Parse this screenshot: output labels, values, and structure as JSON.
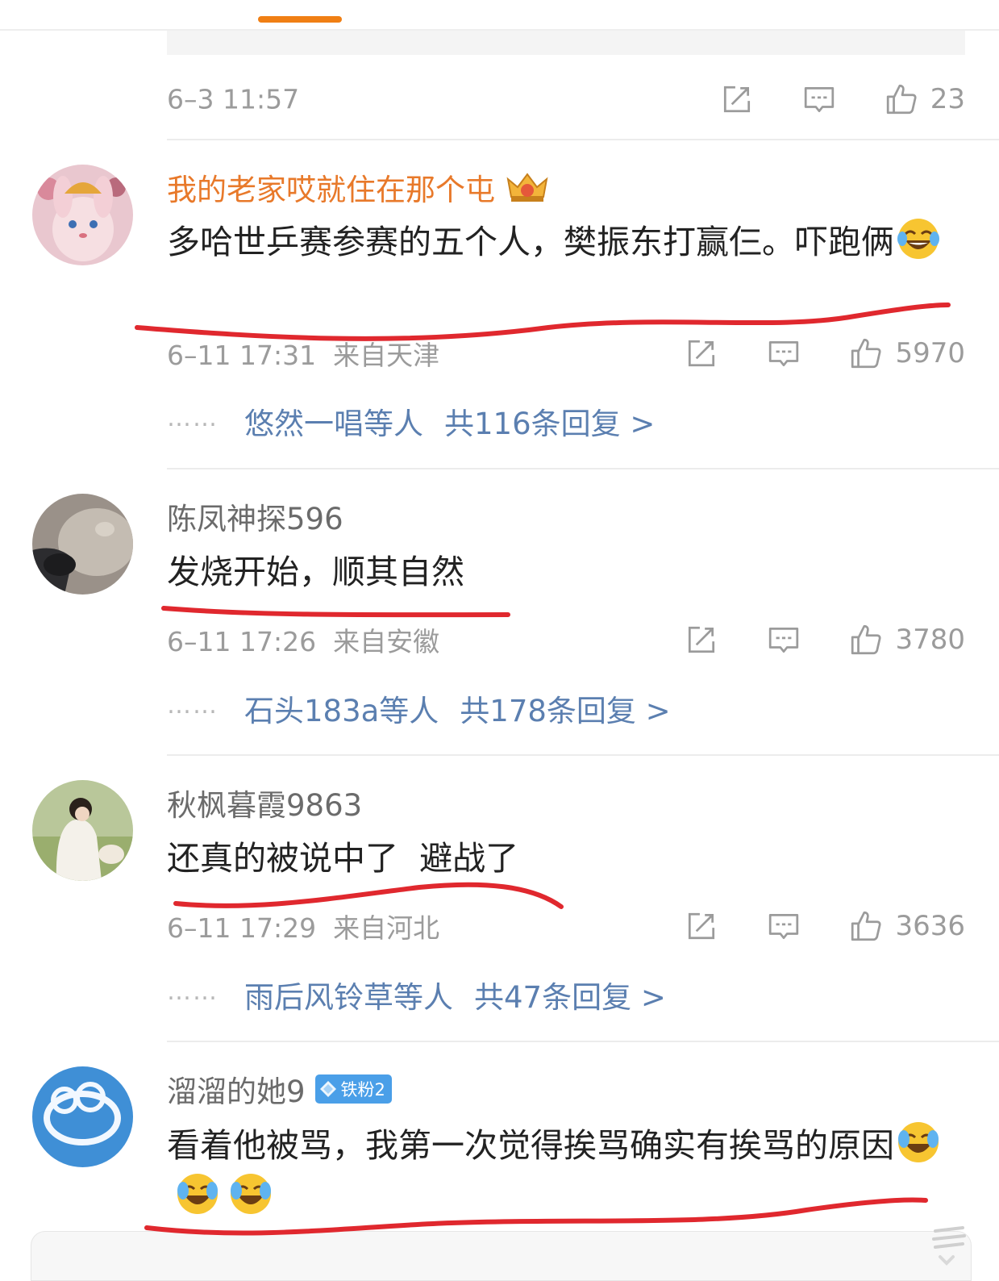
{
  "top": {
    "previous_meta": {
      "time": "6–3 11:57",
      "likes": "23"
    }
  },
  "comments": [
    {
      "username": "我的老家哎就住在那个屯",
      "has_crown": true,
      "text": "多哈世乒赛参赛的五个人，樊振东打赢仨。吓跑俩",
      "emoji_count": 1,
      "meta": {
        "time": "6–11 17:31",
        "location": "来自天津",
        "likes": "5970"
      },
      "replies": {
        "who": "悠然一唱等人",
        "total": "共116条回复 >"
      }
    },
    {
      "username": "陈凤神探596",
      "text": "发烧开始，顺其自然",
      "meta": {
        "time": "6–11 17:26",
        "location": "来自安徽",
        "likes": "3780"
      },
      "replies": {
        "who": "石头183a等人",
        "total": "共178条回复 >"
      }
    },
    {
      "username": "秋枫暮霞9863",
      "text": "还真的被说中了  避战了",
      "meta": {
        "time": "6–11 17:29",
        "location": "来自河北",
        "likes": "3636"
      },
      "replies": {
        "who": "雨后风铃草等人",
        "total": "共47条回复 >"
      }
    },
    {
      "username": "溜溜的她9",
      "badge": "铁粉2",
      "text": "看着他被骂，我第一次觉得挨骂确实有挨骂的原因",
      "emoji_count": 3
    }
  ],
  "reply_dots": "……",
  "icons": {
    "share": "share-icon",
    "comment": "comment-icon",
    "like": "thumbs-up-icon",
    "crown": "crown-icon",
    "emoji": "laughing-tears-emoji",
    "badge": "diamond-icon"
  },
  "colors": {
    "accent_orange": "#f07f14",
    "vip_name": "#e8792a",
    "link_blue": "#5b7fb0",
    "meta_gray": "#9b9b9b",
    "annotation_red": "#e0282e"
  }
}
